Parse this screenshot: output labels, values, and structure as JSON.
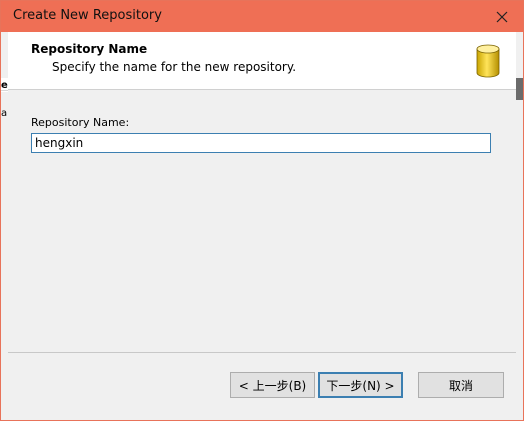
{
  "window": {
    "title": "Create New Repository",
    "accent_color": "#ef6f55"
  },
  "header": {
    "title": "Repository Name",
    "subtitle": "Specify the name for the new repository.",
    "icon": "database-icon"
  },
  "form": {
    "repository_name_label": "Repository Name:",
    "repository_name_value": "hengxin"
  },
  "buttons": {
    "back_label": "< 上一步(B)",
    "next_label": "下一步(N) >",
    "cancel_label": "取消"
  },
  "background_fragments": {
    "left_edge_top": "e",
    "left_edge_bottom": "a"
  }
}
